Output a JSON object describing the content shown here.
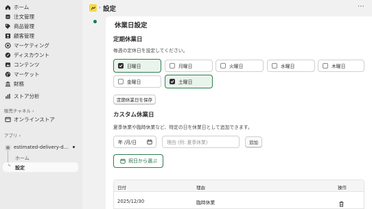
{
  "sidebar": {
    "nav": [
      {
        "label": "ホーム",
        "icon": "home-icon"
      },
      {
        "label": "注文管理",
        "icon": "orders-icon"
      },
      {
        "label": "商品管理",
        "icon": "tag-icon"
      },
      {
        "label": "顧客管理",
        "icon": "person-icon"
      },
      {
        "label": "マーケティング",
        "icon": "target-icon"
      },
      {
        "label": "ディスカウント",
        "icon": "discount-icon"
      },
      {
        "label": "コンテンツ",
        "icon": "content-icon"
      },
      {
        "label": "マーケット",
        "icon": "globe-icon"
      },
      {
        "label": "財務",
        "icon": "bank-icon"
      },
      {
        "label": "ストア分析",
        "icon": "chart-icon"
      }
    ],
    "sales_channels_label": "販売チャネル",
    "online_store_label": "オンラインストア",
    "apps_label": "アプリ",
    "app_name": "estimated-delivery-d...",
    "app_sub_home": "ホーム",
    "app_sub_settings": "設定"
  },
  "header": {
    "separator": "›",
    "title": "設定",
    "more": "···"
  },
  "main": {
    "title": "休業日設定",
    "regular": {
      "title": "定期休業日",
      "description": "毎週の定休日を設定してください。",
      "days": [
        {
          "label": "日曜日",
          "checked": true
        },
        {
          "label": "月曜日",
          "checked": false
        },
        {
          "label": "火曜日",
          "checked": false
        },
        {
          "label": "水曜日",
          "checked": false
        },
        {
          "label": "木曜日",
          "checked": false
        },
        {
          "label": "金曜日",
          "checked": false
        },
        {
          "label": "土曜日",
          "checked": true
        }
      ],
      "save_label": "定期休業日を保存"
    },
    "custom": {
      "title": "カスタム休業日",
      "description": "夏季休業や臨時休業など、特定の日を休業日として追加できます。",
      "date_value": "年 /月/日",
      "reason_placeholder": "理由 (例: 夏季休業)",
      "add_label": "追加",
      "holiday_button_label": "祝日から選ぶ"
    },
    "table": {
      "headers": [
        "日付",
        "理由",
        "操作"
      ],
      "rows": [
        {
          "date": "2025/12/30",
          "reason": "臨時休業"
        }
      ]
    }
  },
  "colors": {
    "accent_green": "#2e7d4f",
    "checked_bg": "#e8f4ec",
    "sidebar_bg": "#ebebeb",
    "page_bg": "#f1f1f1"
  }
}
